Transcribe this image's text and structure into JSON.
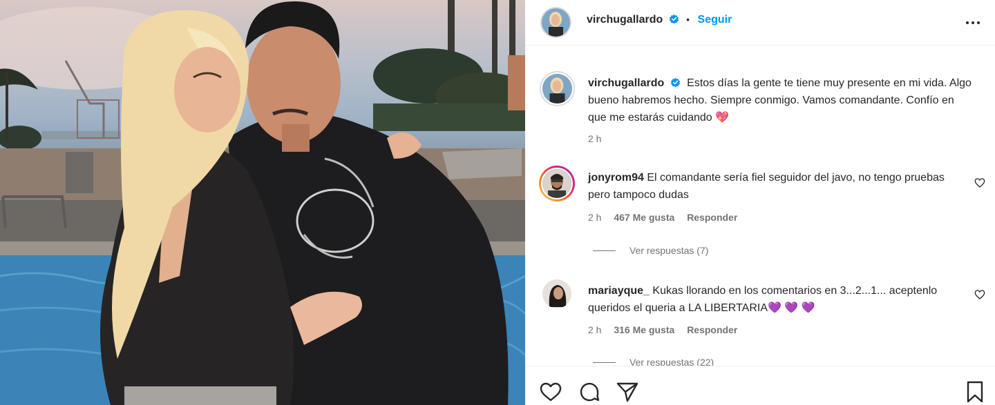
{
  "post": {
    "username": "virchugallardo",
    "dot": "•",
    "follow_label": "Seguir",
    "caption": "Estos días la gente te tiene muy presente en mi vida. Algo bueno habremos hecho. Siempre conmigo. Vamos comandante. Confío en que me estarás cuidando 💖",
    "caption_time": "2 h"
  },
  "comments": [
    {
      "username": "jonyrom94",
      "text": "El comandante sería fiel seguidor del javo, no tengo pruebas pero tampoco dudas",
      "time": "2 h",
      "likes": "467 Me gusta",
      "reply_label": "Responder",
      "view_replies": "Ver respuestas (7)"
    },
    {
      "username": "mariayque_",
      "text": "Kukas llorando en los comentarios en 3...2...1... aceptenlo queridos el queria a LA LIBERTARIA💜 💜 💜",
      "time": "2 h",
      "likes": "316 Me gusta",
      "reply_label": "Responder",
      "view_replies": "Ver respuestas (22)"
    }
  ],
  "colors": {
    "accent": "#0095f6",
    "verified": "#0095f6",
    "muted": "#737373"
  },
  "icons": [
    "more-options-icon",
    "verified-badge-icon",
    "heart-icon",
    "comment-icon",
    "share-icon",
    "save-icon"
  ]
}
